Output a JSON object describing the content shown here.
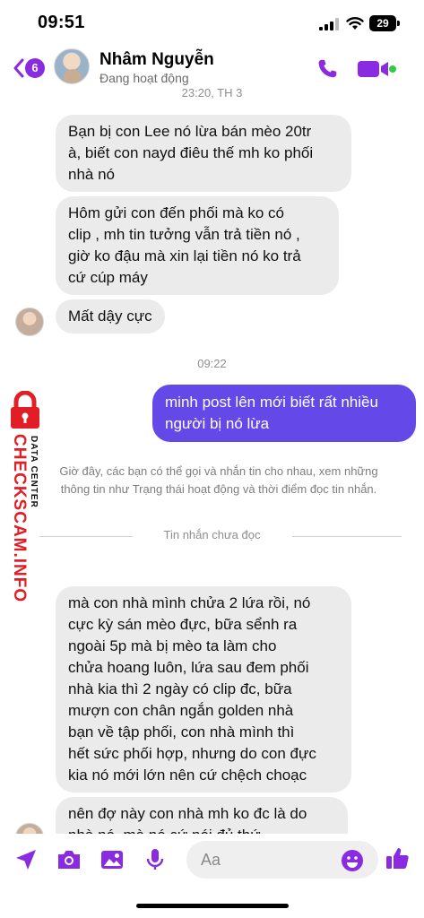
{
  "status_bar": {
    "time": "09:51",
    "battery": "29"
  },
  "header": {
    "back_badge": "6",
    "contact_name": "Nhâm Nguyễn",
    "presence": "Đang hoạt động"
  },
  "conversation": {
    "top_timestamp": "23:20, TH 3",
    "incoming_1": [
      "Bạn bị con Lee nó lừa bán mèo 20tr",
      "à, biết con nayd điêu thế mh ko phối",
      "nhà nó"
    ],
    "incoming_2": [
      "Hôm gửi con đến phối mà ko có",
      "clip , mh tin tưởng vẫn trả tiền nó ,",
      "giờ ko đậu mà xin lại tiền nó ko trả",
      "cứ cúp máy"
    ],
    "incoming_3": [
      "Mất dậy cực"
    ],
    "timestamp_2": "09:22",
    "outgoing_1": [
      "minh post lên mới biết rất nhiều",
      "người bị nó lừa"
    ],
    "info_text": [
      "Giờ đây, các bạn có thể gọi và nhắn tin cho nhau, xem những",
      "thông tin như Trạng thái hoạt động và thời điểm đọc tin nhắn."
    ],
    "unread_label": "Tin nhắn chưa đọc",
    "incoming_4": [
      "mà con nhà mình chửa 2 lứa rồi, nó",
      "cực kỳ sán mèo đực,  bữa sểnh ra",
      "ngoài 5p mà bị mèo ta làm cho",
      "chửa hoang luôn, lứa sau đem phối",
      "nhà kia thì 2 ngày có clip đc, bữa",
      "mượn con chân ngắn golden  nhà",
      "bạn về tập phối,  con nhà mình thì",
      "hết sức phối hợp, nhưng do con đực",
      "kia nó mới lớn nên cứ chệch choạc"
    ],
    "incoming_5": [
      "nên đợ này con nhà mh ko đc là do",
      "nhà nó, mà nó cứ nói đủ thứ"
    ]
  },
  "watermark": {
    "brand": "CHECKSCAM.INFO",
    "sub": "DATA CENTER"
  },
  "composer": {
    "placeholder": "Aa"
  },
  "colors": {
    "accent": "#8a2be2",
    "outgoing_bubble": "#6548e8",
    "incoming_bubble": "#ebebeb",
    "watermark_red": "#e11d26"
  },
  "icons": [
    "back-arrow-icon",
    "phone-icon",
    "video-camera-icon",
    "location-arrow-icon",
    "camera-icon",
    "image-icon",
    "microphone-icon",
    "emoji-icon",
    "thumbs-up-icon"
  ]
}
